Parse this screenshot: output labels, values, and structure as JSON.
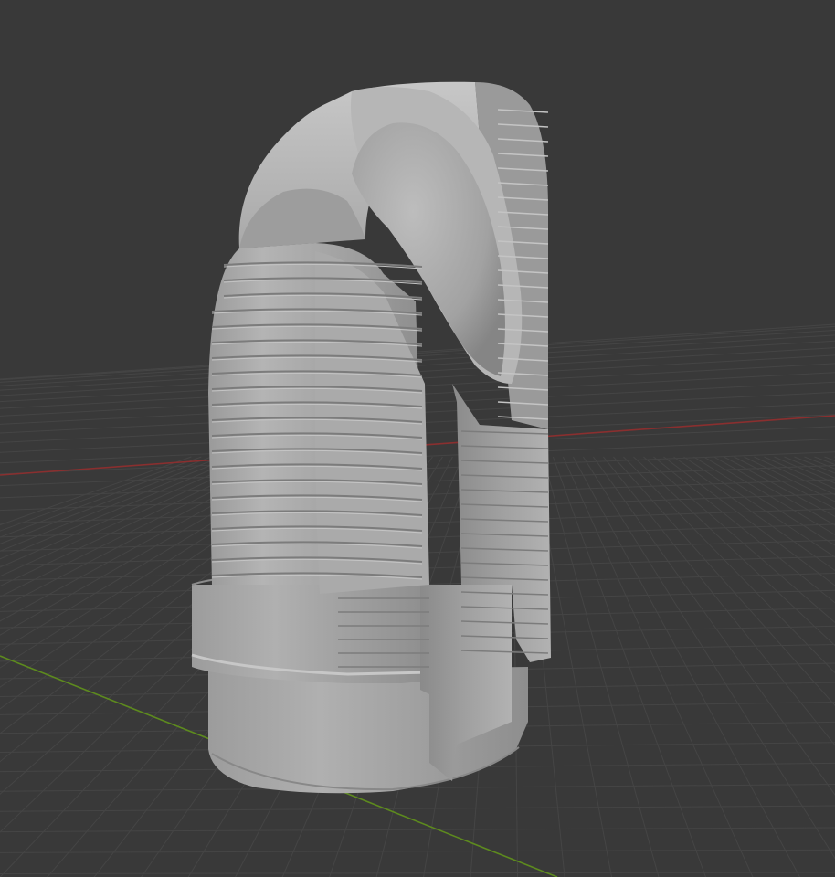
{
  "viewport": {
    "background_color": "#393939",
    "grid_color": "#454545",
    "x_axis_color": "#8a2f2f",
    "y_axis_color": "#5d8a1e"
  },
  "model": {
    "shaded_color": "#a7a7a7",
    "highlight_color": "#c4c4c4",
    "shadow_color": "#7c7c7c"
  }
}
